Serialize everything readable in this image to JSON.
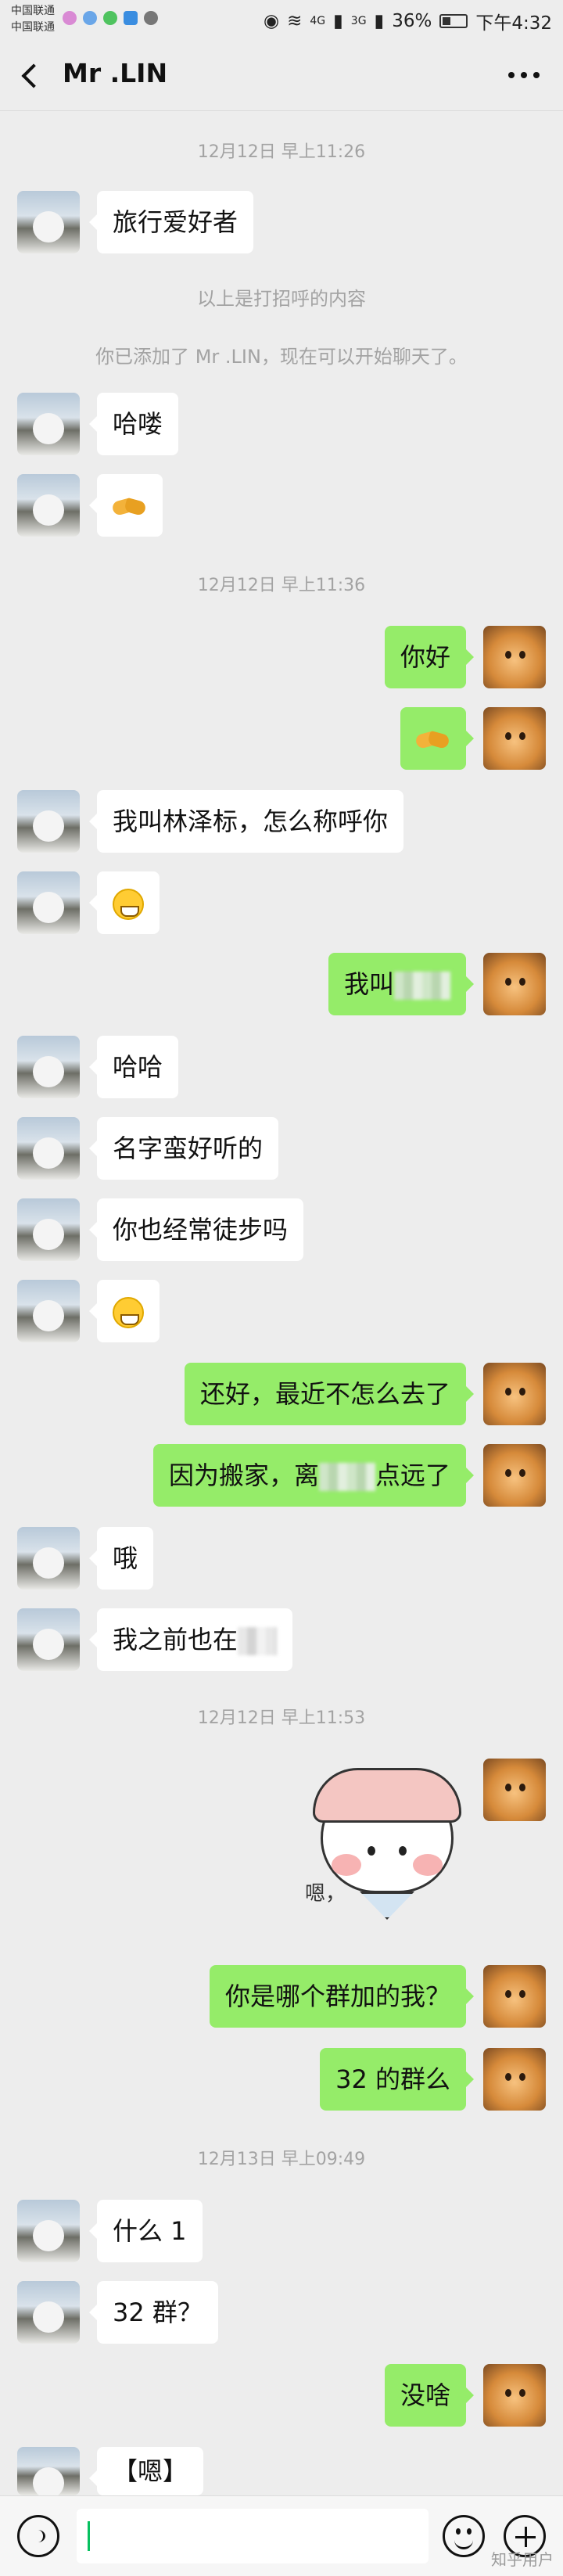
{
  "status_bar": {
    "carrier_1": "中国联通",
    "carrier_2": "中国联通",
    "signal_1": "4G",
    "signal_2": "3G",
    "battery": "36%",
    "time": "下午4:32"
  },
  "header": {
    "title": "Mr .LIN"
  },
  "chat": {
    "time_1": "12月12日 早上11:26",
    "msg_1": "旅行爱好者",
    "sys_1": "以上是打招呼的内容",
    "sys_2": "你已添加了 Mr .LIN，现在可以开始聊天了。",
    "msg_2": "哈喽",
    "time_2": "12月12日 早上11:36",
    "msg_3": "你好",
    "msg_4": "我叫林泽标，怎么称呼你",
    "msg_5": "我叫",
    "msg_6": "哈哈",
    "msg_7": "名字蛮好听的",
    "msg_8": "你也经常徒步吗",
    "msg_9": "还好，最近不怎么去了",
    "msg_10a": "因为搬家，离",
    "msg_10b": "点远了",
    "msg_11": "哦",
    "msg_12": "我之前也在",
    "time_3": "12月12日 早上11:53",
    "sticker_text": "嗯，",
    "msg_13": "你是哪个群加的我？",
    "msg_14": "32 的群么",
    "time_4": "12月13日 早上09:49",
    "msg_15": "什么 1",
    "msg_16": "32 群？",
    "msg_17": "没啥",
    "msg_18": "【嗯】"
  },
  "icons": {
    "back": "chevron-left-icon",
    "more": "more-dots-icon",
    "grin": "grinning-face-icon",
    "handshake": "handshake-icon",
    "voice": "voice-icon",
    "emoji": "emoji-icon",
    "plus": "plus-icon"
  },
  "colors": {
    "background": "#ededed",
    "bubble_self": "#95ec69",
    "bubble_other": "#ffffff",
    "cursor": "#07c160"
  },
  "watermark": "知乎用户"
}
